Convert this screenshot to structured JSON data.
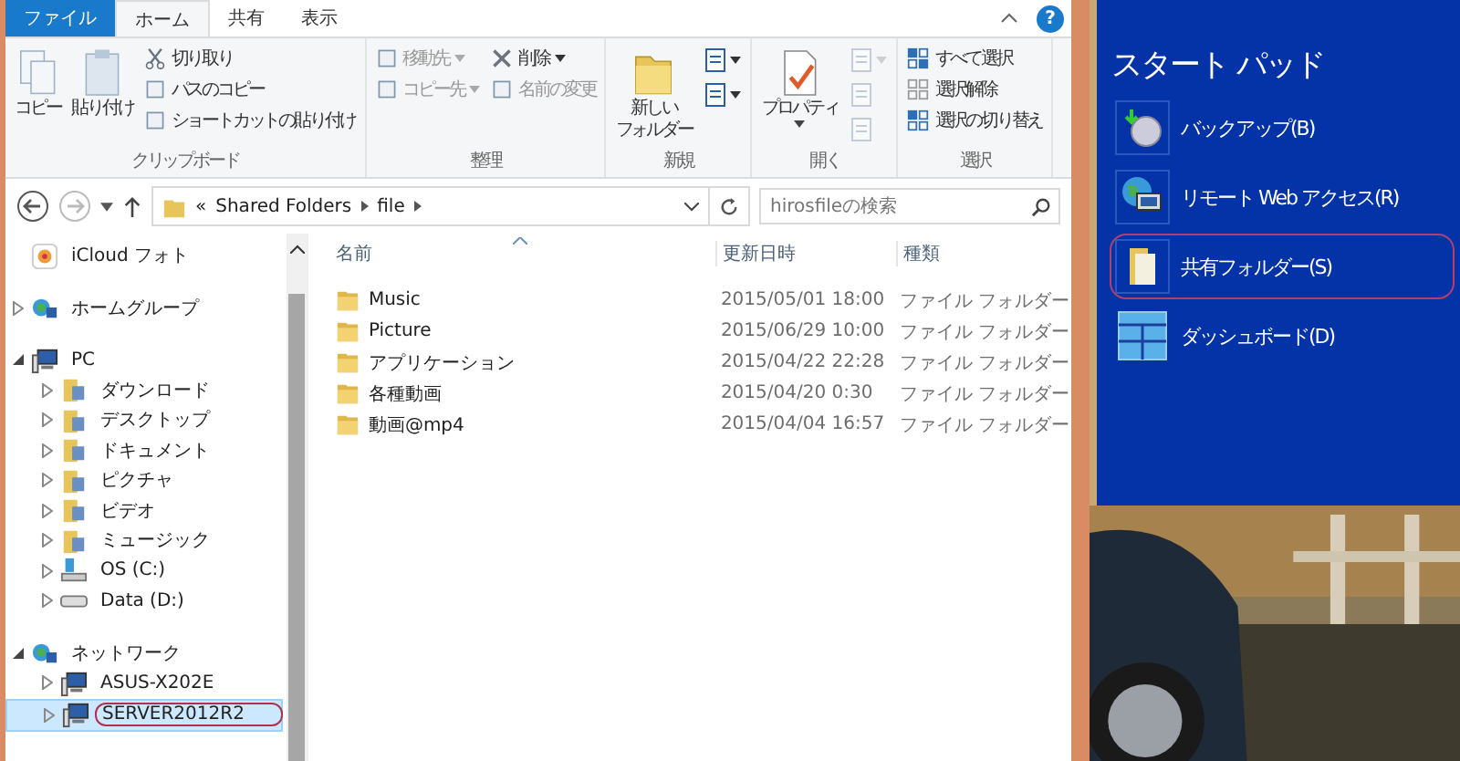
{
  "ribbon": {
    "tabs": [
      {
        "label": "ファイル",
        "kind": "file",
        "selected": false
      },
      {
        "label": "ホーム",
        "kind": "tab",
        "selected": true
      },
      {
        "label": "共有",
        "kind": "tab",
        "selected": false
      },
      {
        "label": "表示",
        "kind": "tab",
        "selected": false
      }
    ],
    "help": "?",
    "groups": [
      {
        "title": "クリップボード",
        "items": [
          {
            "lines": [
              "コピー"
            ],
            "kind": "large",
            "disabled": false
          },
          {
            "lines": [
              "貼り付け"
            ],
            "kind": "large",
            "disabled": false
          },
          {
            "kind": "stack",
            "children": [
              {
                "label": "切り取り",
                "disabled": false
              },
              {
                "label": "パスのコピー",
                "disabled": false
              },
              {
                "label": "ショートカットの貼り付け",
                "disabled": false
              }
            ]
          }
        ]
      },
      {
        "title": "整理",
        "items": [
          {
            "kind": "stack",
            "children": [
              {
                "label": "移動先",
                "dropdown": true,
                "disabled": true
              },
              {
                "label": "コピー先",
                "dropdown": true,
                "disabled": true
              }
            ]
          },
          {
            "kind": "stack",
            "children": [
              {
                "label": "削除",
                "dropdown": true,
                "disabled": false
              },
              {
                "label": "名前の変更",
                "disabled": true
              }
            ]
          }
        ]
      },
      {
        "title": "新規",
        "items": [
          {
            "lines": [
              "新しい",
              "フォルダー"
            ],
            "kind": "large",
            "disabled": false
          },
          {
            "kind": "iconstack",
            "children": [
              {
                "dropdown": true,
                "disabled": false
              },
              {
                "dropdown": true,
                "disabled": false
              }
            ]
          }
        ]
      },
      {
        "title": "開く",
        "items": [
          {
            "lines": [
              "プロパティ"
            ],
            "kind": "large",
            "dropdown": true,
            "disabled": false
          },
          {
            "kind": "iconstack",
            "children": [
              {
                "dropdown": true,
                "disabled": true
              },
              {
                "disabled": true
              },
              {
                "disabled": true
              }
            ]
          }
        ]
      },
      {
        "title": "選択",
        "items": [
          {
            "kind": "stack",
            "children": [
              {
                "label": "すべて選択",
                "disabled": false
              },
              {
                "label": "選択解除",
                "disabled": false
              },
              {
                "label": "選択の切り替え",
                "disabled": false
              }
            ]
          }
        ]
      }
    ]
  },
  "address_bar": {
    "chevron": "«",
    "path": [
      "Shared Folders",
      "file"
    ],
    "search": {
      "placeholder": "hirosfileの検索"
    }
  },
  "sidebar": {
    "items": [
      {
        "label": "iCloud フォト",
        "kind": "photos",
        "selected": false,
        "circled": false
      },
      {
        "label": "ホームグループ",
        "kind": "homegroup",
        "expanded": false,
        "selected": false,
        "circled": false
      },
      {
        "label": "PC",
        "kind": "computer",
        "expanded": true,
        "selected": false,
        "circled": false,
        "children": [
          {
            "label": "ダウンロード",
            "kind": "folder",
            "expanded": false,
            "selected": false,
            "circled": false
          },
          {
            "label": "デスクトップ",
            "kind": "folder",
            "expanded": false,
            "selected": false,
            "circled": false
          },
          {
            "label": "ドキュメント",
            "kind": "folder",
            "expanded": false,
            "selected": false,
            "circled": false
          },
          {
            "label": "ピクチャ",
            "kind": "folder",
            "expanded": false,
            "selected": false,
            "circled": false
          },
          {
            "label": "ビデオ",
            "kind": "folder",
            "expanded": false,
            "selected": false,
            "circled": false
          },
          {
            "label": "ミュージック",
            "kind": "folder",
            "expanded": false,
            "selected": false,
            "circled": false
          },
          {
            "label": "OS (C:)",
            "kind": "drive",
            "expanded": false,
            "selected": false,
            "circled": false
          },
          {
            "label": "Data (D:)",
            "kind": "disk",
            "expanded": false,
            "selected": false,
            "circled": false
          }
        ]
      },
      {
        "label": "ネットワーク",
        "kind": "network",
        "expanded": true,
        "selected": false,
        "circled": false,
        "children": [
          {
            "label": "ASUS-X202E",
            "kind": "computer",
            "expanded": false,
            "selected": false,
            "circled": false
          },
          {
            "label": "SERVER2012R2",
            "kind": "computer",
            "expanded": false,
            "selected": true,
            "circled": true
          }
        ]
      }
    ]
  },
  "table": {
    "columns": [
      "名前",
      "更新日時",
      "種類"
    ],
    "rows": [
      {
        "name": "Music",
        "modified": "2015/05/01 18:00",
        "type": "ファイル フォルダー"
      },
      {
        "name": "Picture",
        "modified": "2015/06/29 10:00",
        "type": "ファイル フォルダー"
      },
      {
        "name": "アプリケーション",
        "modified": "2015/04/22 22:28",
        "type": "ファイル フォルダー"
      },
      {
        "name": "各種動画",
        "modified": "2015/04/20 0:30",
        "type": "ファイル フォルダー"
      },
      {
        "name": "動画@mp4",
        "modified": "2015/04/04 16:57",
        "type": "ファイル フォルダー"
      }
    ]
  },
  "start_pad": {
    "title": "スタート パッド",
    "items": [
      {
        "label": "バックアップ(B)",
        "kind": "backup",
        "circled": false
      },
      {
        "label": "リモート Web アクセス(R)",
        "kind": "remote",
        "circled": false
      },
      {
        "label": "共有フォルダー(S)",
        "kind": "folder",
        "circled": true
      },
      {
        "label": "ダッシュボード(D)",
        "kind": "dashboard",
        "circled": false
      }
    ]
  }
}
